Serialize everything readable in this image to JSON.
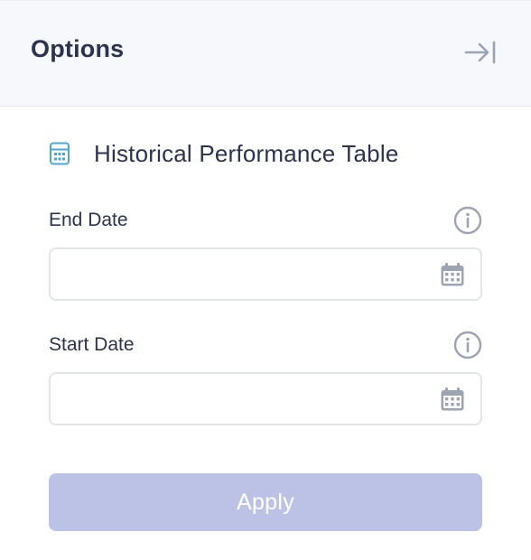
{
  "header": {
    "title": "Options",
    "collapse_icon": "collapse-right-icon"
  },
  "section": {
    "icon": "calculator-icon",
    "icon_color": "#4aa8d8",
    "title": "Historical Performance Table"
  },
  "fields": {
    "end_date": {
      "label": "End Date",
      "value": "",
      "info_icon": "info-icon",
      "calendar_icon": "calendar-icon"
    },
    "start_date": {
      "label": "Start Date",
      "value": "",
      "info_icon": "info-icon",
      "calendar_icon": "calendar-icon"
    }
  },
  "actions": {
    "apply_label": "Apply",
    "apply_disabled": true,
    "apply_color": "#bcc2e6"
  },
  "colors": {
    "text": "#2a3450",
    "icon_gray": "#9ca3b4",
    "header_bg": "#f7f8fc",
    "border": "#e2e4ea"
  }
}
